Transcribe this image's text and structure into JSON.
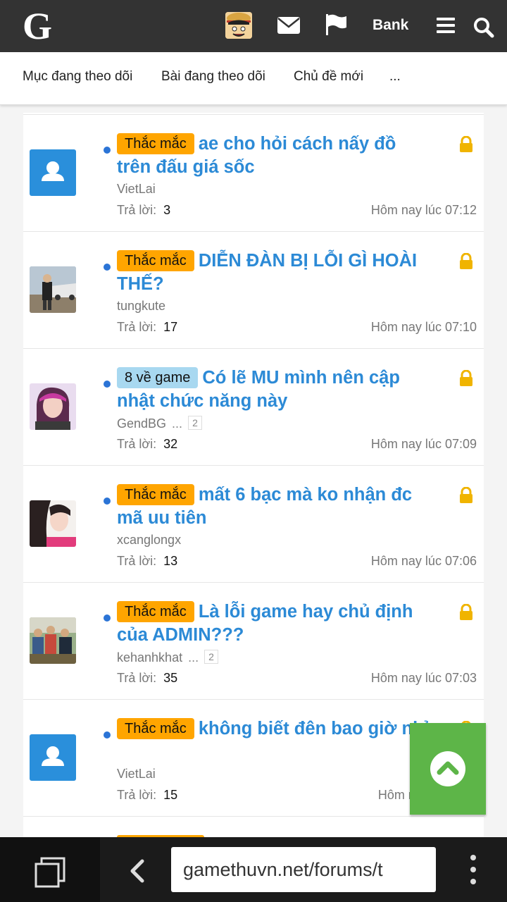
{
  "header": {
    "logo": "G",
    "bank_label": "Bank",
    "icons": [
      "profile-avatar",
      "envelope-icon",
      "flag-icon",
      "menu-icon",
      "search-icon"
    ]
  },
  "subnav": {
    "items": [
      "Mục đang theo dõi",
      "Bài đang theo dõi",
      "Chủ đề mới",
      "..."
    ]
  },
  "threads": [
    {
      "prefix": "Thắc mắc",
      "prefix_color": "#ffa500",
      "title": "ae cho hỏi cách nấy đồ trên đấu giá sốc",
      "author": "VietLai",
      "pages": "",
      "replies_label": "Trả lời:",
      "replies": "3",
      "time": "Hôm nay lúc 07:12",
      "avatar": "default"
    },
    {
      "prefix": "Thắc mắc",
      "prefix_color": "#ffa500",
      "title": "DIỄN ĐÀN BỊ LỖI GÌ HOÀI THẾ?",
      "author": "tungkute",
      "pages": "",
      "replies_label": "Trả lời:",
      "replies": "17",
      "time": "Hôm nay lúc 07:10",
      "avatar": "photo-car"
    },
    {
      "prefix": "8 về game",
      "prefix_color": "#a8d8f0",
      "title": "Có lẽ MU mình nên cập nhật chức năng này",
      "author": "GendBG",
      "pages": "2",
      "replies_label": "Trả lời:",
      "replies": "32",
      "time": "Hôm nay lúc 07:09",
      "avatar": "photo-girl"
    },
    {
      "prefix": "Thắc mắc",
      "prefix_color": "#ffa500",
      "title": "mất 6 bạc mà ko nhận đc mã uu tiên",
      "author": "xcanglongx",
      "pages": "",
      "replies_label": "Trả lời:",
      "replies": "13",
      "time": "Hôm nay lúc 07:06",
      "avatar": "photo-woman"
    },
    {
      "prefix": "Thắc mắc",
      "prefix_color": "#ffa500",
      "title": "Là lỗi game hay chủ định của ADMIN???",
      "author": "kehanhkhat",
      "pages": "2",
      "replies_label": "Trả lời:",
      "replies": "35",
      "time": "Hôm nay lúc 07:03",
      "avatar": "photo-group"
    },
    {
      "prefix": "Thắc mắc",
      "prefix_color": "#ffa500",
      "title": "không biết đên bao giờ nhỉ",
      "author": "VietLai",
      "pages": "",
      "replies_label": "Trả lời:",
      "replies": "15",
      "time": "Hôm nay lúc 07:0",
      "avatar": "default"
    }
  ],
  "browser": {
    "url": "gamethuvn.net/forums/t"
  }
}
